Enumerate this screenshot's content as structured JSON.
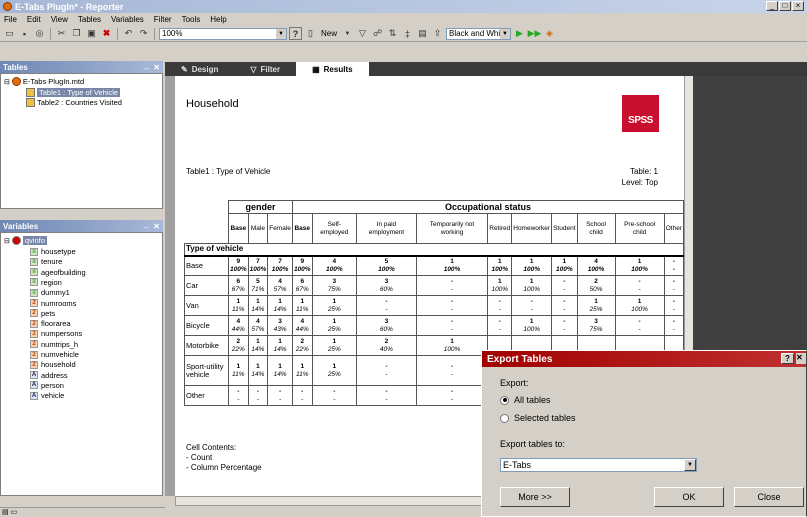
{
  "window": {
    "title": "E-Tabs PlugIn* - Reporter"
  },
  "menu": [
    "File",
    "Edit",
    "View",
    "Tables",
    "Variables",
    "Filter",
    "Tools",
    "Help"
  ],
  "toolbar": {
    "zoom": "100%",
    "new_label": "New",
    "color_mode": "Black and White"
  },
  "tables_panel": {
    "title": "Tables",
    "controls": "← ✕",
    "root": "E-Tabs PlugIn.mtd",
    "items": [
      "Table1 : Type of Vehicle",
      "Table2 : Countries Visited"
    ]
  },
  "variables_panel": {
    "title": "Variables",
    "controls": "← ✕",
    "root": "qvinfo",
    "items": [
      {
        "label": "housetype",
        "kind": "g"
      },
      {
        "label": "tenure",
        "kind": "g"
      },
      {
        "label": "ageofbuilding",
        "kind": "g"
      },
      {
        "label": "region",
        "kind": "g"
      },
      {
        "label": "dummy1",
        "kind": "g"
      },
      {
        "label": "numrooms",
        "kind": "o"
      },
      {
        "label": "pets",
        "kind": "o"
      },
      {
        "label": "floorarea",
        "kind": "o"
      },
      {
        "label": "numpersons",
        "kind": "o"
      },
      {
        "label": "numtrips_h",
        "kind": "o"
      },
      {
        "label": "numvehicle",
        "kind": "o"
      },
      {
        "label": "household",
        "kind": "o"
      },
      {
        "label": "address",
        "kind": "b"
      },
      {
        "label": "person",
        "kind": "b"
      },
      {
        "label": "vehicle",
        "kind": "b"
      }
    ]
  },
  "tabs": [
    "Design",
    "Filter",
    "Results"
  ],
  "report": {
    "heading": "Household",
    "logo": "SPSS",
    "table_caption": "Table1 : Type of Vehicle",
    "table_no": "Table: 1",
    "level": "Level: Top",
    "group_gender": "gender",
    "group_occ": "Occupational status",
    "columns": [
      "Base",
      "Male",
      "Female",
      "Base",
      "Self-employed",
      "In paid employment",
      "Temporarily not working",
      "Retired",
      "Homeworker",
      "Student",
      "School child",
      "Pre-school child",
      "Other"
    ],
    "section": "Type of vehicle",
    "rows": [
      {
        "label": "Base",
        "c": [
          "9",
          "7",
          "7",
          "9",
          "4",
          "5",
          "1",
          "1",
          "1",
          "1",
          "4",
          "1",
          "-"
        ],
        "p": [
          "100%",
          "100%",
          "100%",
          "100%",
          "100%",
          "100%",
          "100%",
          "100%",
          "100%",
          "100%",
          "100%",
          "100%",
          "-"
        ]
      },
      {
        "label": "Car",
        "c": [
          "6",
          "5",
          "4",
          "6",
          "3",
          "3",
          "-",
          "1",
          "1",
          "-",
          "2",
          "-",
          "-"
        ],
        "p": [
          "67%",
          "71%",
          "57%",
          "67%",
          "75%",
          "60%",
          "-",
          "100%",
          "100%",
          "-",
          "50%",
          "-",
          "-"
        ]
      },
      {
        "label": "Van",
        "c": [
          "1",
          "1",
          "1",
          "1",
          "1",
          "-",
          "-",
          "-",
          "-",
          "-",
          "1",
          "1",
          "-"
        ],
        "p": [
          "11%",
          "14%",
          "14%",
          "11%",
          "25%",
          "-",
          "-",
          "-",
          "-",
          "-",
          "25%",
          "100%",
          "-"
        ]
      },
      {
        "label": "Bicycle",
        "c": [
          "4",
          "4",
          "3",
          "4",
          "1",
          "3",
          "-",
          "-",
          "1",
          "-",
          "3",
          "-",
          "-"
        ],
        "p": [
          "44%",
          "57%",
          "43%",
          "44%",
          "25%",
          "60%",
          "-",
          "-",
          "100%",
          "-",
          "75%",
          "-",
          "-"
        ]
      },
      {
        "label": "Motorbike",
        "c": [
          "2",
          "1",
          "1",
          "2",
          "1",
          "2",
          "1",
          "",
          "",
          "",
          "",
          "",
          ""
        ],
        "p": [
          "22%",
          "14%",
          "14%",
          "22%",
          "25%",
          "40%",
          "100%",
          "",
          "",
          "",
          "",
          "",
          ""
        ]
      },
      {
        "label": "Sport-utility vehicle",
        "c": [
          "1",
          "1",
          "1",
          "1",
          "1",
          "-",
          "-",
          "",
          "",
          "",
          "",
          "",
          ""
        ],
        "p": [
          "11%",
          "14%",
          "14%",
          "11%",
          "25%",
          "-",
          "-",
          "",
          "",
          "",
          "",
          "",
          ""
        ]
      },
      {
        "label": "Other",
        "c": [
          "-",
          "-",
          "-",
          "-",
          "-",
          "-",
          "-",
          "",
          "",
          "",
          "",
          "",
          ""
        ],
        "p": [
          "-",
          "-",
          "-",
          "-",
          "-",
          "-",
          "-",
          "",
          "",
          "",
          "",
          "",
          ""
        ]
      }
    ],
    "cell_contents_title": "Cell Contents:",
    "cell_contents": [
      "- Count",
      "- Column Percentage"
    ]
  },
  "dialog": {
    "title": "Export Tables",
    "help": "?",
    "close": "✕",
    "export_label": "Export:",
    "opt_all": "All tables",
    "opt_selected": "Selected tables",
    "export_to_label": "Export tables to:",
    "export_to_value": "E-Tabs",
    "more": "More >>",
    "ok": "OK",
    "close_btn": "Close"
  }
}
